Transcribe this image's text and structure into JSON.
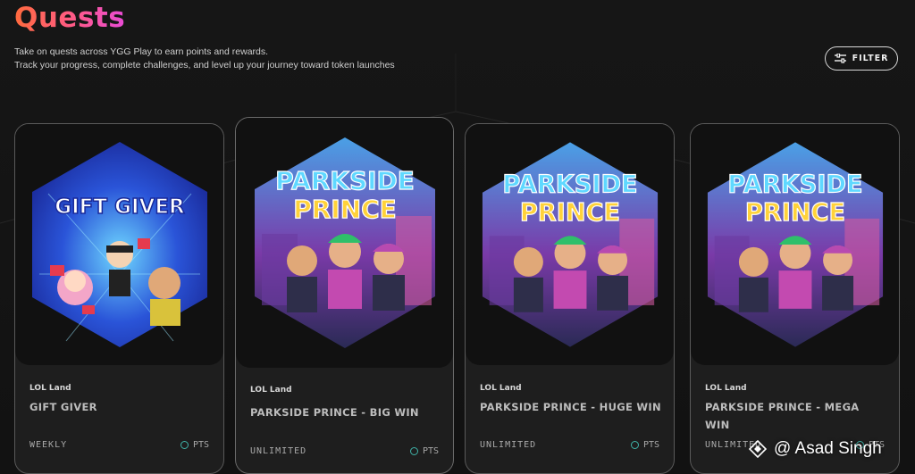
{
  "header": {
    "title": "Quests",
    "subtitle_line1": "Take on quests across YGG Play to earn points and rewards.",
    "subtitle_line2": "Track your progress, complete challenges, and level up your journey toward token launches",
    "filter_label": "FILTER"
  },
  "cards": [
    {
      "game": "LOL Land",
      "name": "GIFT GIVER",
      "frequency": "WEEKLY",
      "points_label": "PTS",
      "art_text": "GIFT GIVER"
    },
    {
      "game": "LOL Land",
      "name": "PARKSIDE PRINCE - BIG WIN",
      "frequency": "UNLIMITED",
      "points_label": "PTS",
      "art_text_1": "PARKSIDE",
      "art_text_2": "PRINCE"
    },
    {
      "game": "LOL Land",
      "name": "PARKSIDE PRINCE - HUGE WIN",
      "frequency": "UNLIMITED",
      "points_label": "PTS",
      "art_text_1": "PARKSIDE",
      "art_text_2": "PRINCE"
    },
    {
      "game": "LOL Land",
      "name": "PARKSIDE PRINCE - MEGA WIN",
      "frequency": "UNLIMITED",
      "points_label": "PTS",
      "art_text_1": "PARKSIDE",
      "art_text_2": "PRINCE"
    }
  ],
  "watermark": {
    "text": "@ Asad Singh"
  },
  "colors": {
    "title_gradient_start": "#ff6a3d",
    "title_gradient_end": "#e84bd6",
    "points_icon": "#3fb3a8",
    "card_border": "#5a5a5a"
  }
}
